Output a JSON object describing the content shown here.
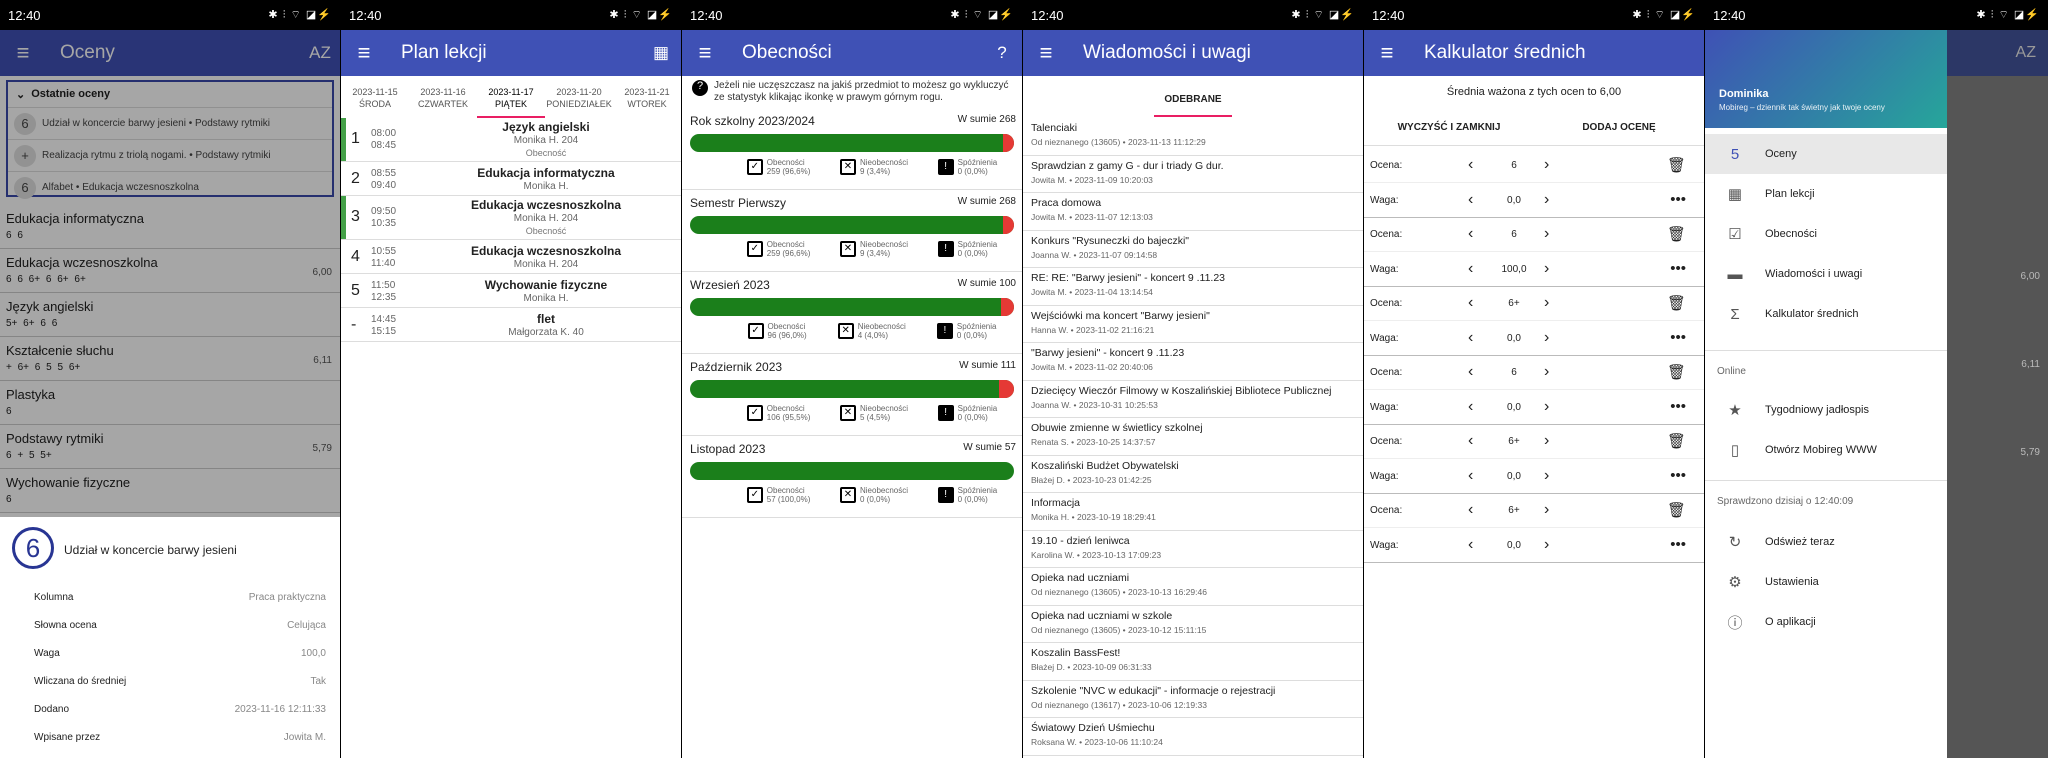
{
  "status": {
    "time": "12:40",
    "icons_left": "☒ ◔ ◎ ▭ ···",
    "icons_right": "✱ ⫶ ⌔ ◪⚡"
  },
  "grades": {
    "title": "Oceny",
    "sort": "AZ",
    "recent_header": "Ostatnie oceny",
    "recent": [
      {
        "badge": "6",
        "text": "Udział w koncercie barwy jesieni • Podstawy rytmiki"
      },
      {
        "badge": "+",
        "text": "Realizacja rytmu z triolą nogami. • Podstawy rytmiki"
      },
      {
        "badge": "6",
        "text": "Alfabet • Edukacja wczesnoszkolna"
      }
    ],
    "subjects": [
      {
        "name": "Edukacja informatyczna",
        "grades": "6 6",
        "avg": ""
      },
      {
        "name": "Edukacja wczesnoszkolna",
        "grades": "6 6 6+ 6 6+ 6+",
        "avg": "6,00"
      },
      {
        "name": "Język angielski",
        "grades": "5+ 6+ 6 6",
        "avg": ""
      },
      {
        "name": "Kształcenie słuchu",
        "grades": "+ 6+ 6 5 5 6+",
        "avg": "6,11"
      },
      {
        "name": "Plastyka",
        "grades": "6",
        "avg": ""
      },
      {
        "name": "Podstawy rytmiki",
        "grades": "6 + 5 5+",
        "avg": "5,79"
      },
      {
        "name": "Wychowanie fizyczne",
        "grades": "6",
        "avg": ""
      }
    ],
    "detail": {
      "grade": "6",
      "title": "Udział w koncercie barwy jesieni",
      "rows": [
        {
          "k": "Kolumna",
          "v": "Praca praktyczna"
        },
        {
          "k": "Słowna ocena",
          "v": "Celująca"
        },
        {
          "k": "Waga",
          "v": "100,0"
        },
        {
          "k": "Wliczana do średniej",
          "v": "Tak"
        },
        {
          "k": "Dodano",
          "v": "2023-11-16 12:11:33"
        },
        {
          "k": "Wpisane przez",
          "v": "Jowita M."
        }
      ]
    }
  },
  "schedule": {
    "title": "Plan lekcji",
    "dates": [
      {
        "d": "2023-11-15",
        "w": "ŚRODA"
      },
      {
        "d": "2023-11-16",
        "w": "CZWARTEK"
      },
      {
        "d": "2023-11-17",
        "w": "PIĄTEK"
      },
      {
        "d": "2023-11-20",
        "w": "PONIEDZIAŁEK"
      },
      {
        "d": "2023-11-21",
        "w": "WTOREK"
      }
    ],
    "lessons": [
      {
        "no": "1",
        "start": "08:00",
        "end": "08:45",
        "name": "Język angielski",
        "teacher": "Monika H. 204",
        "note": "Obecność"
      },
      {
        "no": "2",
        "start": "08:55",
        "end": "09:40",
        "name": "Edukacja informatyczna",
        "teacher": "Monika H.",
        "note": ""
      },
      {
        "no": "3",
        "start": "09:50",
        "end": "10:35",
        "name": "Edukacja wczesnoszkolna",
        "teacher": "Monika H. 204",
        "note": "Obecność"
      },
      {
        "no": "4",
        "start": "10:55",
        "end": "11:40",
        "name": "Edukacja wczesnoszkolna",
        "teacher": "Monika H. 204",
        "note": ""
      },
      {
        "no": "5",
        "start": "11:50",
        "end": "12:35",
        "name": "Wychowanie fizyczne",
        "teacher": "Monika H.",
        "note": ""
      },
      {
        "no": "-",
        "start": "14:45",
        "end": "15:15",
        "name": "flet",
        "teacher": "Małgorzata K. 40",
        "note": ""
      }
    ]
  },
  "attendance": {
    "title": "Obecności",
    "info": "Jeżeli nie uczęszczasz na jakiś przedmiot to możesz go wykluczyć ze statystyk klikając ikonkę w prawym górnym rogu.",
    "labels": {
      "present": "Obecności",
      "absent": "Nieobecności",
      "late": "Spóźnienia"
    },
    "periods": [
      {
        "name": "Rok szkolny 2023/2024",
        "sum": "W sumie 268",
        "present": "259 (96,6%)",
        "absent": "9 (3,4%)",
        "late": "0 (0,0%)",
        "ratio": 0.966
      },
      {
        "name": "Semestr Pierwszy",
        "sum": "W sumie 268",
        "present": "259 (96,6%)",
        "absent": "9 (3,4%)",
        "late": "0 (0,0%)",
        "ratio": 0.966
      },
      {
        "name": "Wrzesień 2023",
        "sum": "W sumie 100",
        "present": "96 (96,0%)",
        "absent": "4 (4,0%)",
        "late": "0 (0,0%)",
        "ratio": 0.96
      },
      {
        "name": "Październik 2023",
        "sum": "W sumie 111",
        "present": "106 (95,5%)",
        "absent": "5 (4,5%)",
        "late": "0 (0,0%)",
        "ratio": 0.955
      },
      {
        "name": "Listopad 2023",
        "sum": "W sumie 57",
        "present": "57 (100,0%)",
        "absent": "0 (0,0%)",
        "late": "0 (0,0%)",
        "ratio": 1.0
      }
    ]
  },
  "messages": {
    "title": "Wiadomości i uwagi",
    "tab": "ODEBRANE",
    "items": [
      {
        "t": "Talenciaki",
        "m": "Od nieznanego (13605) • 2023-11-13 11:12:29"
      },
      {
        "t": "Sprawdzian z gamy G - dur i triady G dur.",
        "m": "Jowita M. • 2023-11-09 10:20:03"
      },
      {
        "t": "Praca domowa",
        "m": "Jowita M. • 2023-11-07 12:13:03"
      },
      {
        "t": "Konkurs \"Rysuneczki do bajeczki\"",
        "m": "Joanna W. • 2023-11-07 09:14:58"
      },
      {
        "t": "RE: RE: \"Barwy jesieni\" - koncert 9 .11.23",
        "m": "Jowita M. • 2023-11-04 13:14:54"
      },
      {
        "t": "Wejściówki ma koncert \"Barwy jesieni\"",
        "m": "Hanna W. • 2023-11-02 21:16:21"
      },
      {
        "t": "\"Barwy jesieni\" - koncert 9 .11.23",
        "m": "Jowita M. • 2023-11-02 20:40:06"
      },
      {
        "t": "Dziecięcy Wieczór Filmowy w Koszalińskiej Bibliotece Publicznej",
        "m": "Joanna W. • 2023-10-31 10:25:53"
      },
      {
        "t": "Obuwie zmienne w świetlicy szkolnej",
        "m": "Renata S. • 2023-10-25 14:37:57"
      },
      {
        "t": "Koszaliński Budżet Obywatelski",
        "m": "Błażej D. • 2023-10-23 01:42:25"
      },
      {
        "t": "Informacja",
        "m": "Monika H. • 2023-10-19 18:29:41"
      },
      {
        "t": "19.10 - dzień leniwca",
        "m": "Karolina W. • 2023-10-13 17:09:23"
      },
      {
        "t": "Opieka nad uczniami",
        "m": "Od nieznanego (13605) • 2023-10-13 16:29:46"
      },
      {
        "t": "Opieka nad uczniami w szkole",
        "m": "Od nieznanego (13605) • 2023-10-12 15:11:15"
      },
      {
        "t": "Koszalin BassFest!",
        "m": "Błażej D. • 2023-10-09 06:31:33"
      },
      {
        "t": "Szkolenie \"NVC w edukacji\" - informacje o rejestracji",
        "m": "Od nieznanego (13617) • 2023-10-06 12:19:33"
      },
      {
        "t": "Światowy Dzień Uśmiechu",
        "m": "Roksana W. • 2023-10-06 11:10:24"
      }
    ]
  },
  "calc": {
    "title": "Kalkulator średnich",
    "result": "Średnia ważona z tych ocen to 6,00",
    "clear": "WYCZYŚĆ I ZAMKNIJ",
    "add": "DODAJ OCENĘ",
    "grade_label": "Ocena:",
    "weight_label": "Waga:",
    "entries": [
      {
        "grade": "6",
        "weight": "0,0"
      },
      {
        "grade": "6",
        "weight": "100,0"
      },
      {
        "grade": "6+",
        "weight": "0,0"
      },
      {
        "grade": "6",
        "weight": "0,0"
      },
      {
        "grade": "6+",
        "weight": "0,0"
      },
      {
        "grade": "6+",
        "weight": "0,0"
      }
    ]
  },
  "drawer": {
    "user": "Dominika",
    "tagline": "Mobireg – dziennik tak świetny jak twoje oceny",
    "items": [
      {
        "label": "Oceny",
        "icon": "5"
      },
      {
        "label": "Plan lekcji",
        "icon": "▦"
      },
      {
        "label": "Obecności",
        "icon": "☑"
      },
      {
        "label": "Wiadomości i uwagi",
        "icon": "▬"
      },
      {
        "label": "Kalkulator średnich",
        "icon": "Σ"
      }
    ],
    "online_header": "Online",
    "online": [
      {
        "label": "Tygodniowy jadłospis",
        "icon": "★"
      },
      {
        "label": "Otwórz Mobireg WWW",
        "icon": "▯"
      }
    ],
    "checked": "Sprawdzono dzisiaj o 12:40:09",
    "bottom": [
      {
        "label": "Odśwież teraz",
        "icon": "↻"
      },
      {
        "label": "Ustawienia",
        "icon": "⚙"
      },
      {
        "label": "O aplikacji",
        "icon": "ⓘ"
      }
    ],
    "behind_sort": "AZ",
    "behind_avgs": [
      "6,00",
      "6,11",
      "5,79"
    ]
  }
}
